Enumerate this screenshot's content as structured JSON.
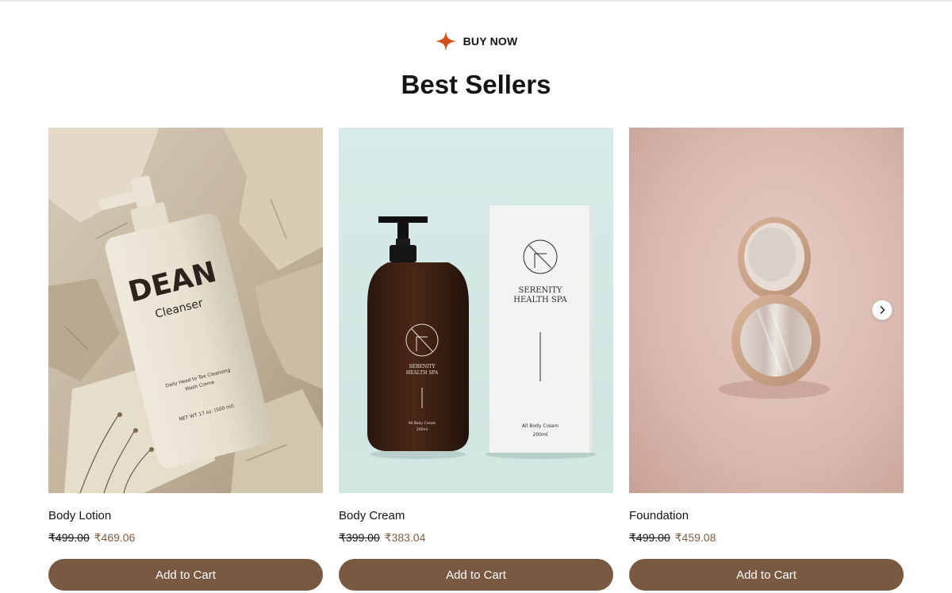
{
  "section": {
    "eyebrow_label": "BUY NOW",
    "title": "Best Sellers"
  },
  "products": [
    {
      "name": "Body Lotion",
      "original_price": "₹499.00",
      "sale_price": "₹469.06",
      "button_label": "Add to Cart",
      "image_text": [
        "DEAN",
        "Cleanser",
        "Daily Head to Toe Cleansing",
        "Wash Creme",
        "NET WT 17 oz. (500 ml)"
      ]
    },
    {
      "name": "Body Cream",
      "original_price": "₹399.00",
      "sale_price": "₹383.04",
      "button_label": "Add to Cart",
      "image_text": [
        "SERENITY",
        "HEALTH SPA",
        "All Body Cream",
        "200ml",
        "SERENITY",
        "HEALTH SPA",
        "All Body Cream",
        "200ml"
      ]
    },
    {
      "name": "Foundation",
      "original_price": "₹499.00",
      "sale_price": "₹459.08",
      "button_label": "Add to Cart",
      "image_text": []
    }
  ],
  "icons": {
    "eyebrow": "sparkle-star-icon",
    "carousel_next": "chevron-right-icon"
  },
  "colors": {
    "accent_star": "#d4501e",
    "button_bg": "#7a5942",
    "sale_price": "#7d5d43",
    "text": "#151414"
  }
}
